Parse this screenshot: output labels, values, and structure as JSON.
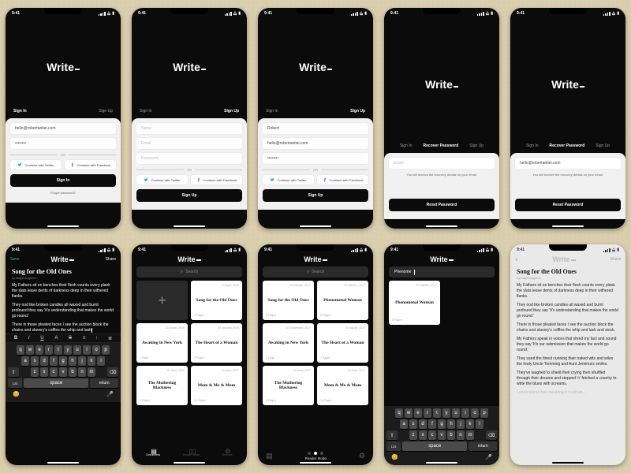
{
  "status": {
    "time": "9:41",
    "wifi_icon": "wifi-icon",
    "signal_icon": "signal-icon",
    "battery_icon": "battery-icon"
  },
  "brand": {
    "name": "Write",
    "suffix": "_"
  },
  "auth": {
    "tabs": {
      "signin": "Sign In",
      "signup": "Sign Up",
      "recover": "Recover Password"
    },
    "fields": {
      "email_value": "hello@robertanitei.com",
      "email_ph": "Email",
      "password_dots": "••••••••",
      "password_ph": "Password",
      "name_value": "Robert",
      "name_ph": "Name"
    },
    "or": "OR",
    "social": {
      "twitter": "Continue with Twitter",
      "facebook": "Continue with Facebook"
    },
    "buttons": {
      "signin": "Sign In",
      "signup": "Sign Up",
      "reset": "Reset Password"
    },
    "forgot": "Forgot password?",
    "recover_note": "You will receive the recovery details on your email."
  },
  "editor": {
    "save": "Save",
    "share": "Share",
    "title": "Song for the Old Ones",
    "byline": "by Maya Angelou",
    "paras_dark": [
      "My Fathers sit on benches their flesh counts every plank the slats leave dents of darkness deep in their withered flanks.",
      "They nod like broken candles all waxed and burnt profound they say 'It's understanding that makes the world go round.'",
      "There in those pleated faces I see the auction block the chains and slavery's coffles the whip and lash"
    ],
    "paras_light": [
      "My Fathers sit on benches their flesh counts every plank the slats leave dents of darkness deep in their withered flanks.",
      "They nod like broken candles all waxed and burnt profound they say 'It's understanding that makes the world go round.'",
      "There in those pleated faces I see the auction block the chains and slavery's coffles the whip and lash and stock.",
      "My Fathers speak in voices that shred my fact and sound they say 'It's our submission that makes the world go round.'",
      "They used the finest cunning their naked wits and wiles the lowly Uncle Tomming and Aunt Jemima's smiles.",
      "They've laughed to shield their crying then shuffled through their dreams and stepped 'n' fetched a country to write the blues with screams.",
      "I understand their meaning it could an..."
    ],
    "format": {
      "b": "B",
      "i": "I",
      "u": "U",
      "a": "A",
      "strike": "S",
      "bullet": "≡",
      "number": "⦙",
      "align": "≣"
    }
  },
  "keyboard": {
    "rows": [
      [
        "q",
        "w",
        "e",
        "r",
        "t",
        "y",
        "u",
        "i",
        "o",
        "p"
      ],
      [
        "a",
        "s",
        "d",
        "f",
        "g",
        "h",
        "j",
        "k",
        "l"
      ],
      [
        "z",
        "x",
        "c",
        "v",
        "b",
        "n",
        "m"
      ]
    ],
    "shift": "⇧",
    "del": "⌫",
    "num": "123",
    "space": "space",
    "ret": "return",
    "emoji": "😊",
    "mic": "🎤"
  },
  "browser": {
    "search_ph": "Search",
    "search_value": "Phenome",
    "cards_a": [
      {
        "date": "10 April, 2018",
        "title": "Song for the Old Ones",
        "pages": "4 Pages"
      },
      {
        "date": "20 March, 2018",
        "title": "Awaking in New York",
        "pages": "1 Page"
      },
      {
        "date": "03 January, 2018",
        "title": "The Heart of a Woman",
        "pages": "7 Pages"
      },
      {
        "date": "21 June, 2017",
        "title": "The Mothering Blackness",
        "pages": "2 Pages"
      },
      {
        "date": "15 June, 2017",
        "title": "Mom & Me & Mom",
        "pages": "14 Pages"
      }
    ],
    "cards_b": [
      {
        "date": "10 October, 2017",
        "title": "Song for the Old Ones",
        "pages": "3 Pages"
      },
      {
        "date": "02 October, 2017",
        "title": "Phenomenal Woman",
        "pages": "5 Pages"
      },
      {
        "date": "01 September, 2017",
        "title": "Awaking in New York",
        "pages": "1 Page"
      },
      {
        "date": "03 August, 2017",
        "title": "The Heart of a Woman",
        "pages": "7 Pages"
      },
      {
        "date": "21 June, 2017",
        "title": "The Mothering Blackness",
        "pages": "2 Pages"
      },
      {
        "date": "15 June, 2017",
        "title": "Mom & Me & Mom",
        "pages": "14 Pages"
      }
    ],
    "cards_c": [
      {
        "date": "02 October, 2017",
        "title": "Phenomenal Woman",
        "pages": "5 Pages"
      }
    ],
    "tabs": {
      "documents": "Documents",
      "reader": "Reader Mode",
      "settings": "Settings"
    },
    "back": "‹"
  }
}
